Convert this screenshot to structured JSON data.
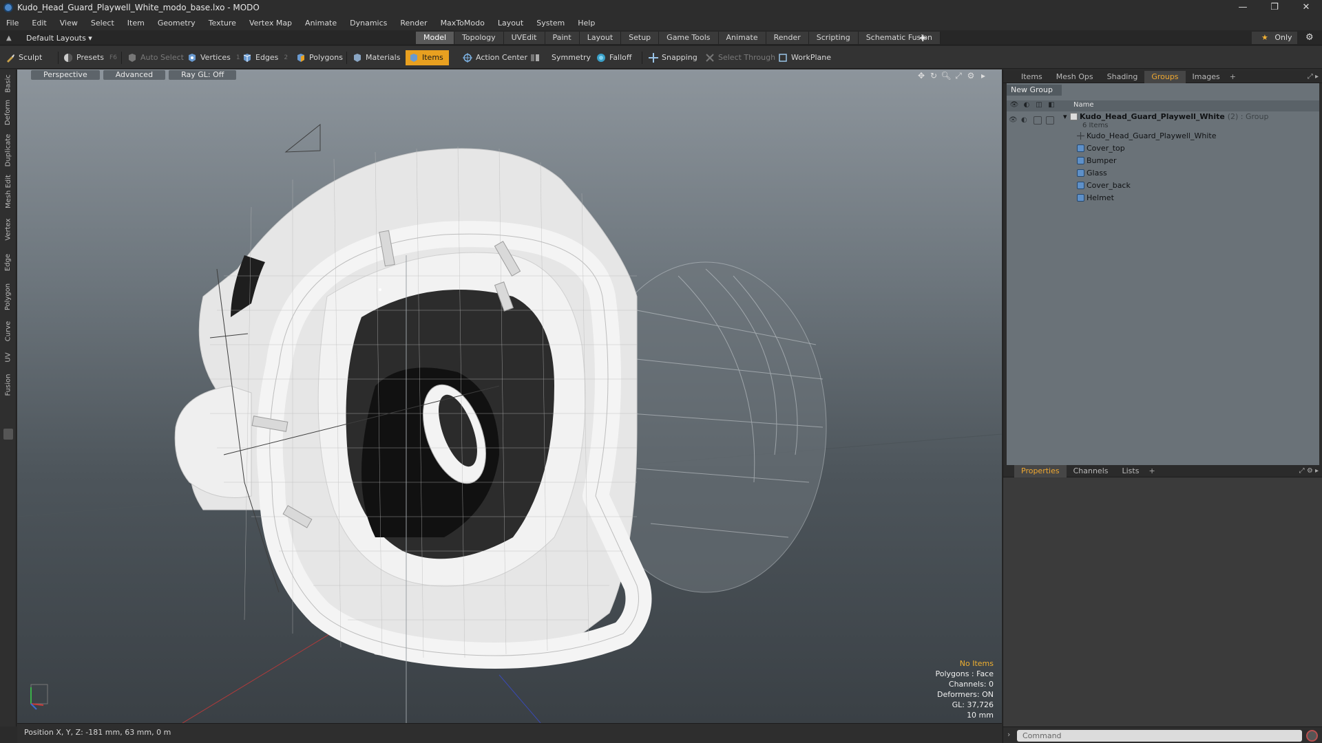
{
  "window": {
    "title": "Kudo_Head_Guard_Playwell_White_modo_base.lxo - MODO"
  },
  "menu": [
    "File",
    "Edit",
    "View",
    "Select",
    "Item",
    "Geometry",
    "Texture",
    "Vertex Map",
    "Animate",
    "Dynamics",
    "Render",
    "MaxToModo",
    "Layout",
    "System",
    "Help"
  ],
  "layoutbar": {
    "layouts_label": "Default Layouts ▾",
    "tabs": [
      "Model",
      "Topology",
      "UVEdit",
      "Paint",
      "Layout",
      "Setup",
      "Game Tools",
      "Animate",
      "Render",
      "Scripting",
      "Schematic Fusion"
    ],
    "active_tab": "Model",
    "only_label": "Only"
  },
  "toolbar": {
    "sculpt": "Sculpt",
    "presets": "Presets",
    "presets_key": "F6",
    "auto_select": "Auto Select",
    "vertices": "Vertices",
    "vertices_count": "1",
    "edges": "Edges",
    "edges_count": "2",
    "polygons": "Polygons",
    "materials": "Materials",
    "items": "Items",
    "action_center": "Action Center",
    "symmetry": "Symmetry",
    "falloff": "Falloff",
    "snapping": "Snapping",
    "select_through": "Select Through",
    "workplane": "WorkPlane"
  },
  "left_tabs": [
    "Basic",
    "Deform",
    "Duplicate",
    "Mesh Edit",
    "Vertex",
    "Edge",
    "Polygon",
    "Curve",
    "UV",
    "Fusion"
  ],
  "viewport": {
    "view_mode": "Perspective",
    "shading": "Advanced",
    "raygl": "Ray GL: Off",
    "info": {
      "selection": "No Items",
      "polygons": "Polygons : Face",
      "channels": "Channels: 0",
      "deformers": "Deformers: ON",
      "gl": "GL: 37,726",
      "scale": "10 mm"
    }
  },
  "status": {
    "position": "Position X, Y, Z:  -181 mm, 63 mm, 0 m"
  },
  "right_panel": {
    "tabs": [
      "Items",
      "Mesh Ops",
      "Shading",
      "Groups",
      "Images"
    ],
    "active_tab": "Groups",
    "new_group": "New Group",
    "column_name": "Name",
    "group": {
      "name": "Kudo_Head_Guard_Playwell_White",
      "extra": "(2) : Group",
      "count": "6 Items"
    },
    "children": [
      {
        "name": "Kudo_Head_Guard_Playwell_White",
        "icon": "locator-icon"
      },
      {
        "name": "Cover_top",
        "icon": "mesh-icon"
      },
      {
        "name": "Bumper",
        "icon": "mesh-icon"
      },
      {
        "name": "Glass",
        "icon": "mesh-icon"
      },
      {
        "name": "Cover_back",
        "icon": "mesh-icon"
      },
      {
        "name": "Helmet",
        "icon": "mesh-icon"
      }
    ],
    "bottom_tabs": [
      "Properties",
      "Channels",
      "Lists"
    ],
    "bottom_active": "Properties",
    "command_placeholder": "Command"
  },
  "colors": {
    "accent": "#e8a020",
    "viewport_top": "#8d959c",
    "viewport_bottom": "#3a4045"
  }
}
